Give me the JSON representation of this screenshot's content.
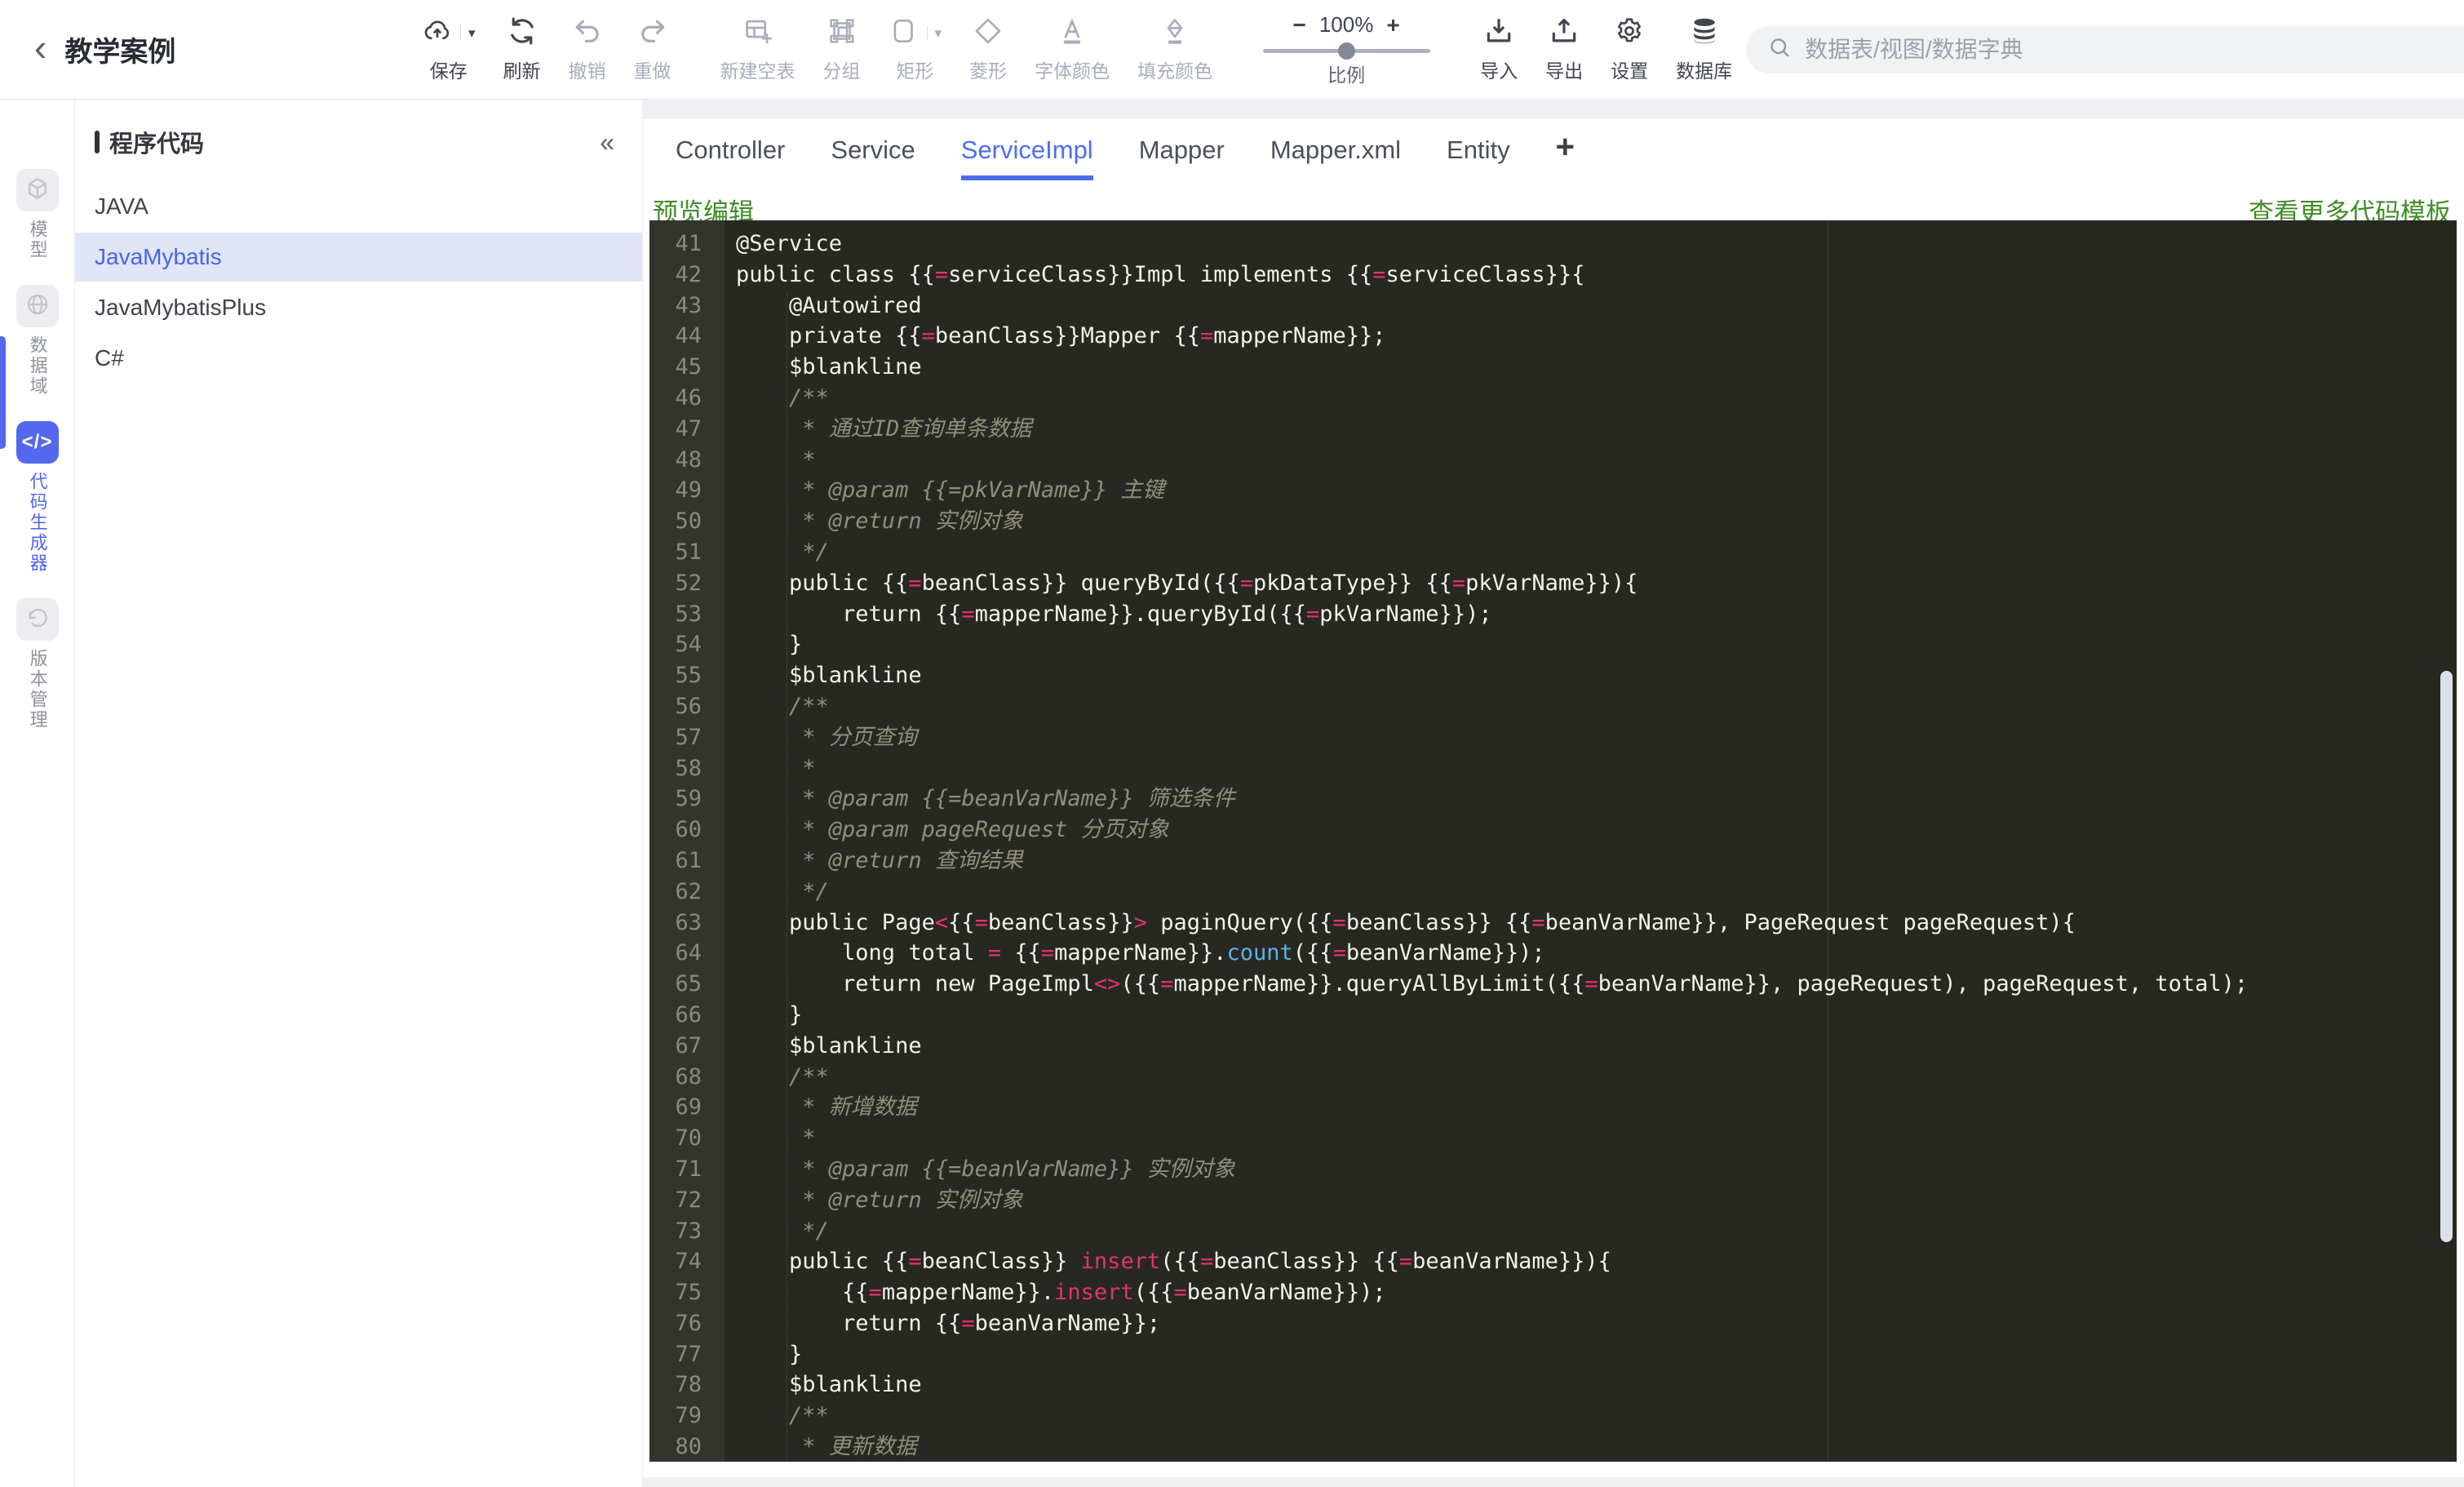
{
  "colors": {
    "accent_blue": "#4e6cf2",
    "sidebar_blue": "#5468ee",
    "link_green": "#3f8d27",
    "editor_bg": "#282823",
    "gutter_bg": "#34342e",
    "code_plain": "#f2f2ec",
    "code_pink": "#e0336e",
    "code_cyan": "#5cb3e6",
    "code_comment": "#8f8f7a",
    "selected_row_bg": "#e0e5f8"
  },
  "header": {
    "back_icon": "‹",
    "title": "教学案例",
    "toolbar": {
      "save": {
        "label": "保存",
        "icon": "cloud-upload-icon",
        "state": "normal",
        "caret": "▾"
      },
      "refresh": {
        "label": "刷新",
        "icon": "refresh-icon",
        "state": "normal"
      },
      "undo": {
        "label": "撤销",
        "icon": "undo-icon",
        "state": "disabled"
      },
      "redo": {
        "label": "重做",
        "icon": "redo-icon",
        "state": "disabled"
      },
      "new_table": {
        "label": "新建空表",
        "icon": "table-plus-icon",
        "state": "disabled"
      },
      "group": {
        "label": "分组",
        "icon": "group-icon",
        "state": "disabled"
      },
      "rect": {
        "label": "矩形",
        "icon": "rectangle-icon",
        "state": "disabled",
        "caret": "▾"
      },
      "diamond": {
        "label": "菱形",
        "icon": "diamond-icon",
        "state": "disabled"
      },
      "font_color": {
        "label": "字体颜色",
        "icon": "font-color-icon",
        "state": "disabled"
      },
      "fill_color": {
        "label": "填充颜色",
        "icon": "fill-color-icon",
        "state": "disabled"
      },
      "import": {
        "label": "导入",
        "icon": "import-icon",
        "state": "normal"
      },
      "export": {
        "label": "导出",
        "icon": "export-icon",
        "state": "normal"
      },
      "settings": {
        "label": "设置",
        "icon": "gear-icon",
        "state": "normal"
      },
      "database": {
        "label": "数据库",
        "icon": "database-icon",
        "state": "normal"
      }
    },
    "zoom": {
      "minus": "−",
      "value": "100%",
      "plus": "+",
      "label": "比例"
    },
    "search": {
      "placeholder": "数据表/视图/数据字典",
      "icon": "search-icon"
    }
  },
  "sidebar": {
    "items": [
      {
        "label": "模型",
        "icon": "cube-icon",
        "active": false
      },
      {
        "label": "数据域",
        "icon": "globe-icon",
        "active": false
      },
      {
        "label": "代码生成器",
        "icon": "code-icon",
        "active": true
      },
      {
        "label": "版本管理",
        "icon": "history-icon",
        "active": false
      }
    ]
  },
  "panel": {
    "title": "程序代码",
    "collapse_icon": "«",
    "items": [
      {
        "label": "JAVA",
        "selected": false
      },
      {
        "label": "JavaMybatis",
        "selected": true
      },
      {
        "label": "JavaMybatisPlus",
        "selected": false
      },
      {
        "label": "C#",
        "selected": false
      }
    ]
  },
  "main": {
    "tabs": [
      {
        "label": "Controller"
      },
      {
        "label": "Service"
      },
      {
        "label": "ServiceImpl",
        "active": true
      },
      {
        "label": "Mapper"
      },
      {
        "label": "Mapper.xml"
      },
      {
        "label": "Entity"
      }
    ],
    "add_tab": "+",
    "preview_link": "预览编辑",
    "more_link": "查看更多代码模板",
    "editor": {
      "first_line": 41,
      "last_line": 80,
      "lines": [
        {
          "n": 41,
          "s": [
            [
              "@Service",
              "p"
            ]
          ]
        },
        {
          "n": 42,
          "s": [
            [
              "public class {{",
              "p"
            ],
            [
              "=",
              "k"
            ],
            [
              "serviceClass}}Impl implements {{",
              "p"
            ],
            [
              "=",
              "k"
            ],
            [
              "serviceClass}}{",
              "p"
            ]
          ]
        },
        {
          "n": 43,
          "s": [
            [
              "    @Autowired",
              "p"
            ]
          ]
        },
        {
          "n": 44,
          "s": [
            [
              "    private {{",
              "p"
            ],
            [
              "=",
              "k"
            ],
            [
              "beanClass}}Mapper {{",
              "p"
            ],
            [
              "=",
              "k"
            ],
            [
              "mapperName}};",
              "p"
            ]
          ]
        },
        {
          "n": 45,
          "s": [
            [
              "    $blankline",
              "p"
            ]
          ]
        },
        {
          "n": 46,
          "s": [
            [
              "    /**",
              "m"
            ]
          ]
        },
        {
          "n": 47,
          "s": [
            [
              "     * 通过ID查询单条数据",
              "m"
            ]
          ]
        },
        {
          "n": 48,
          "s": [
            [
              "     *",
              "m"
            ]
          ]
        },
        {
          "n": 49,
          "s": [
            [
              "     * @param {{=pkVarName}} 主键",
              "m"
            ]
          ]
        },
        {
          "n": 50,
          "s": [
            [
              "     * @return 实例对象",
              "m"
            ]
          ]
        },
        {
          "n": 51,
          "s": [
            [
              "     */",
              "m"
            ]
          ]
        },
        {
          "n": 52,
          "s": [
            [
              "    public {{",
              "p"
            ],
            [
              "=",
              "k"
            ],
            [
              "beanClass}} queryById({{",
              "p"
            ],
            [
              "=",
              "k"
            ],
            [
              "pkDataType}} {{",
              "p"
            ],
            [
              "=",
              "k"
            ],
            [
              "pkVarName}}){",
              "p"
            ]
          ]
        },
        {
          "n": 53,
          "s": [
            [
              "        return {{",
              "p"
            ],
            [
              "=",
              "k"
            ],
            [
              "mapperName}}.queryById({{",
              "p"
            ],
            [
              "=",
              "k"
            ],
            [
              "pkVarName}});",
              "p"
            ]
          ]
        },
        {
          "n": 54,
          "s": [
            [
              "    }",
              "p"
            ]
          ]
        },
        {
          "n": 55,
          "s": [
            [
              "    $blankline",
              "p"
            ]
          ]
        },
        {
          "n": 56,
          "s": [
            [
              "    /**",
              "m"
            ]
          ]
        },
        {
          "n": 57,
          "s": [
            [
              "     * 分页查询",
              "m"
            ]
          ]
        },
        {
          "n": 58,
          "s": [
            [
              "     *",
              "m"
            ]
          ]
        },
        {
          "n": 59,
          "s": [
            [
              "     * @param {{=beanVarName}} 筛选条件",
              "m"
            ]
          ]
        },
        {
          "n": 60,
          "s": [
            [
              "     * @param pageRequest 分页对象",
              "m"
            ]
          ]
        },
        {
          "n": 61,
          "s": [
            [
              "     * @return 查询结果",
              "m"
            ]
          ]
        },
        {
          "n": 62,
          "s": [
            [
              "     */",
              "m"
            ]
          ]
        },
        {
          "n": 63,
          "s": [
            [
              "    public Page",
              "p"
            ],
            [
              "<",
              "k"
            ],
            [
              "{{",
              "p"
            ],
            [
              "=",
              "k"
            ],
            [
              "beanClass}}",
              "p"
            ],
            [
              ">",
              "k"
            ],
            [
              " paginQuery({{",
              "p"
            ],
            [
              "=",
              "k"
            ],
            [
              "beanClass}} {{",
              "p"
            ],
            [
              "=",
              "k"
            ],
            [
              "beanVarName}}, PageRequest pageRequest){",
              "p"
            ]
          ]
        },
        {
          "n": 64,
          "s": [
            [
              "        long total ",
              "p"
            ],
            [
              "=",
              "k"
            ],
            [
              " {{",
              "p"
            ],
            [
              "=",
              "k"
            ],
            [
              "mapperName}}.",
              "p"
            ],
            [
              "count",
              "c"
            ],
            [
              "({{",
              "p"
            ],
            [
              "=",
              "k"
            ],
            [
              "beanVarName}});",
              "p"
            ]
          ]
        },
        {
          "n": 65,
          "s": [
            [
              "        return new PageImpl",
              "p"
            ],
            [
              "<>",
              "k"
            ],
            [
              "({{",
              "p"
            ],
            [
              "=",
              "k"
            ],
            [
              "mapperName}}.queryAllByLimit({{",
              "p"
            ],
            [
              "=",
              "k"
            ],
            [
              "beanVarName}}, pageRequest), pageRequest, total);",
              "p"
            ]
          ]
        },
        {
          "n": 66,
          "s": [
            [
              "    }",
              "p"
            ]
          ]
        },
        {
          "n": 67,
          "s": [
            [
              "    $blankline",
              "p"
            ]
          ]
        },
        {
          "n": 68,
          "s": [
            [
              "    /**",
              "m"
            ]
          ]
        },
        {
          "n": 69,
          "s": [
            [
              "     * 新增数据",
              "m"
            ]
          ]
        },
        {
          "n": 70,
          "s": [
            [
              "     *",
              "m"
            ]
          ]
        },
        {
          "n": 71,
          "s": [
            [
              "     * @param {{=beanVarName}} 实例对象",
              "m"
            ]
          ]
        },
        {
          "n": 72,
          "s": [
            [
              "     * @return 实例对象",
              "m"
            ]
          ]
        },
        {
          "n": 73,
          "s": [
            [
              "     */",
              "m"
            ]
          ]
        },
        {
          "n": 74,
          "s": [
            [
              "    public {{",
              "p"
            ],
            [
              "=",
              "k"
            ],
            [
              "beanClass}} ",
              "p"
            ],
            [
              "insert",
              "k"
            ],
            [
              "({{",
              "p"
            ],
            [
              "=",
              "k"
            ],
            [
              "beanClass}} {{",
              "p"
            ],
            [
              "=",
              "k"
            ],
            [
              "beanVarName}}){",
              "p"
            ]
          ]
        },
        {
          "n": 75,
          "s": [
            [
              "        {{",
              "p"
            ],
            [
              "=",
              "k"
            ],
            [
              "mapperName}}.",
              "p"
            ],
            [
              "insert",
              "k"
            ],
            [
              "({{",
              "p"
            ],
            [
              "=",
              "k"
            ],
            [
              "beanVarName}});",
              "p"
            ]
          ]
        },
        {
          "n": 76,
          "s": [
            [
              "        return {{",
              "p"
            ],
            [
              "=",
              "k"
            ],
            [
              "beanVarName}};",
              "p"
            ]
          ]
        },
        {
          "n": 77,
          "s": [
            [
              "    }",
              "p"
            ]
          ]
        },
        {
          "n": 78,
          "s": [
            [
              "    $blankline",
              "p"
            ]
          ]
        },
        {
          "n": 79,
          "s": [
            [
              "    /**",
              "m"
            ]
          ]
        },
        {
          "n": 80,
          "s": [
            [
              "     * 更新数据",
              "m"
            ]
          ]
        }
      ]
    }
  }
}
